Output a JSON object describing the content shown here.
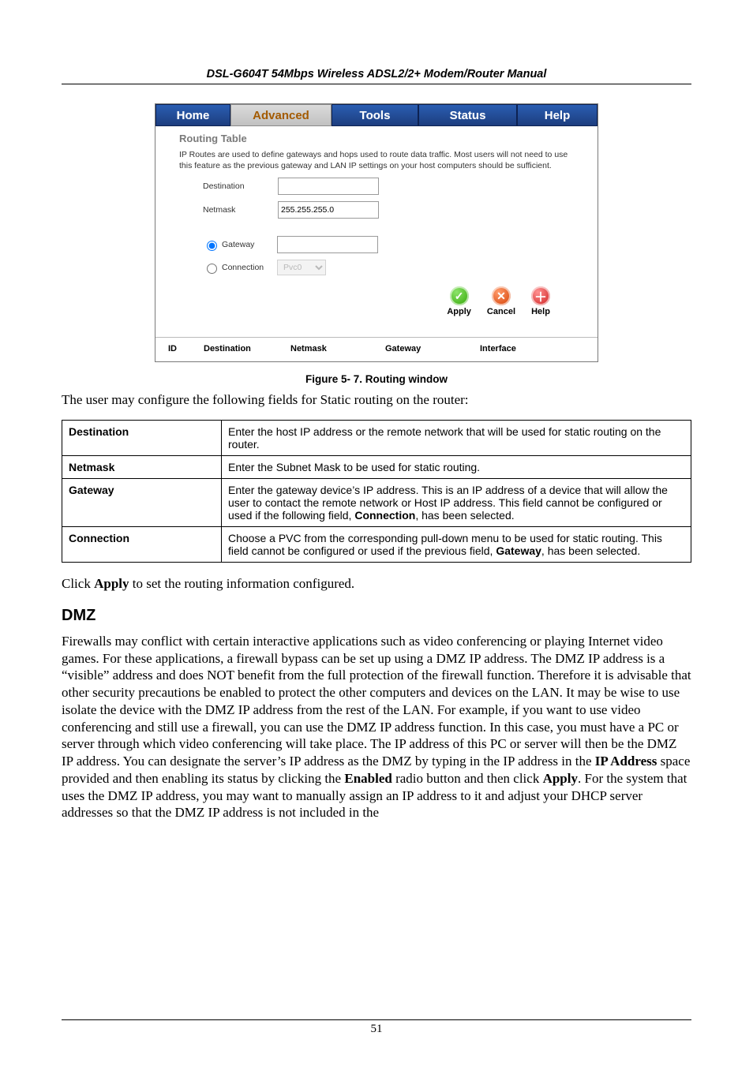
{
  "runningHead": "DSL-G604T 54Mbps Wireless ADSL2/2+ Modem/Router Manual",
  "pageNumber": "51",
  "caption": "Figure 5- 7. Routing window",
  "introLine": "The user may configure the following fields for Static routing on the router:",
  "applyLinePre": "Click ",
  "applyLineBold": "Apply",
  "applyLinePost": " to set the routing information configured.",
  "dmzHeading": "DMZ",
  "dmzParaParts": [
    "Firewalls may conflict with certain interactive applications such as video conferencing or playing Internet video games. For these applications, a firewall bypass can be set up using a DMZ IP address. The DMZ IP address is a “visible” address and does NOT benefit from the full protection of the firewall function. Therefore it is advisable that other security precautions be enabled to protect the other computers and devices on the LAN. It may be wise to use isolate the device with the DMZ IP address from the rest of the LAN. For example, if you want to use video conferencing and still use a firewall, you can use the DMZ IP address function. In this case, you must have a PC or server through which video conferencing will take place. The IP address of this PC or server will then be the DMZ IP address. You can designate the server’s IP address as the DMZ by typing in the IP address in the ",
    "IP Address",
    " space provided and then enabling its status by clicking the ",
    "Enabled",
    " radio button and then click ",
    "Apply",
    ". For the system that uses the DMZ IP address, you may want to manually assign an IP address to it and adjust your DHCP server addresses so that the DMZ IP address is not included in the"
  ],
  "ui": {
    "tabs": {
      "home": "Home",
      "advanced": "Advanced",
      "tools": "Tools",
      "status": "Status",
      "help": "Help"
    },
    "sectionTitle": "Routing Table",
    "sectionDesc": "IP Routes are used to define gateways and hops used to route data traffic. Most users will not need to use this feature as the previous gateway and LAN IP settings on your host computers should be sufficient.",
    "labels": {
      "destination": "Destination",
      "netmask": "Netmask",
      "gateway": "Gateway",
      "connection": "Connection"
    },
    "values": {
      "destination": "",
      "netmask": "255.255.255.0",
      "gateway": "",
      "connection": "Pvc0"
    },
    "buttons": {
      "apply": "Apply",
      "cancel": "Cancel",
      "help": "Help"
    },
    "tableHead": {
      "id": "ID",
      "destination": "Destination",
      "netmask": "Netmask",
      "gateway": "Gateway",
      "interface": "Interface"
    }
  },
  "fields": [
    {
      "name": "Destination",
      "desc": "Enter the host IP address or the remote network that will be used for static routing on the router."
    },
    {
      "name": "Netmask",
      "desc": "Enter the Subnet Mask to be used for static routing."
    },
    {
      "name": "Gateway",
      "descPre": "Enter the gateway device’s IP address. This is an IP address of a device that will allow the user to contact the remote network or Host IP address. This field cannot be configured or used if the following field, ",
      "descBold": "Connection",
      "descPost": ", has been selected."
    },
    {
      "name": "Connection",
      "descPre": "Choose a PVC from the corresponding pull-down menu to be used for static routing. This field cannot be configured or used if the previous field, ",
      "descBold": "Gateway",
      "descPost": ", has been selected."
    }
  ]
}
